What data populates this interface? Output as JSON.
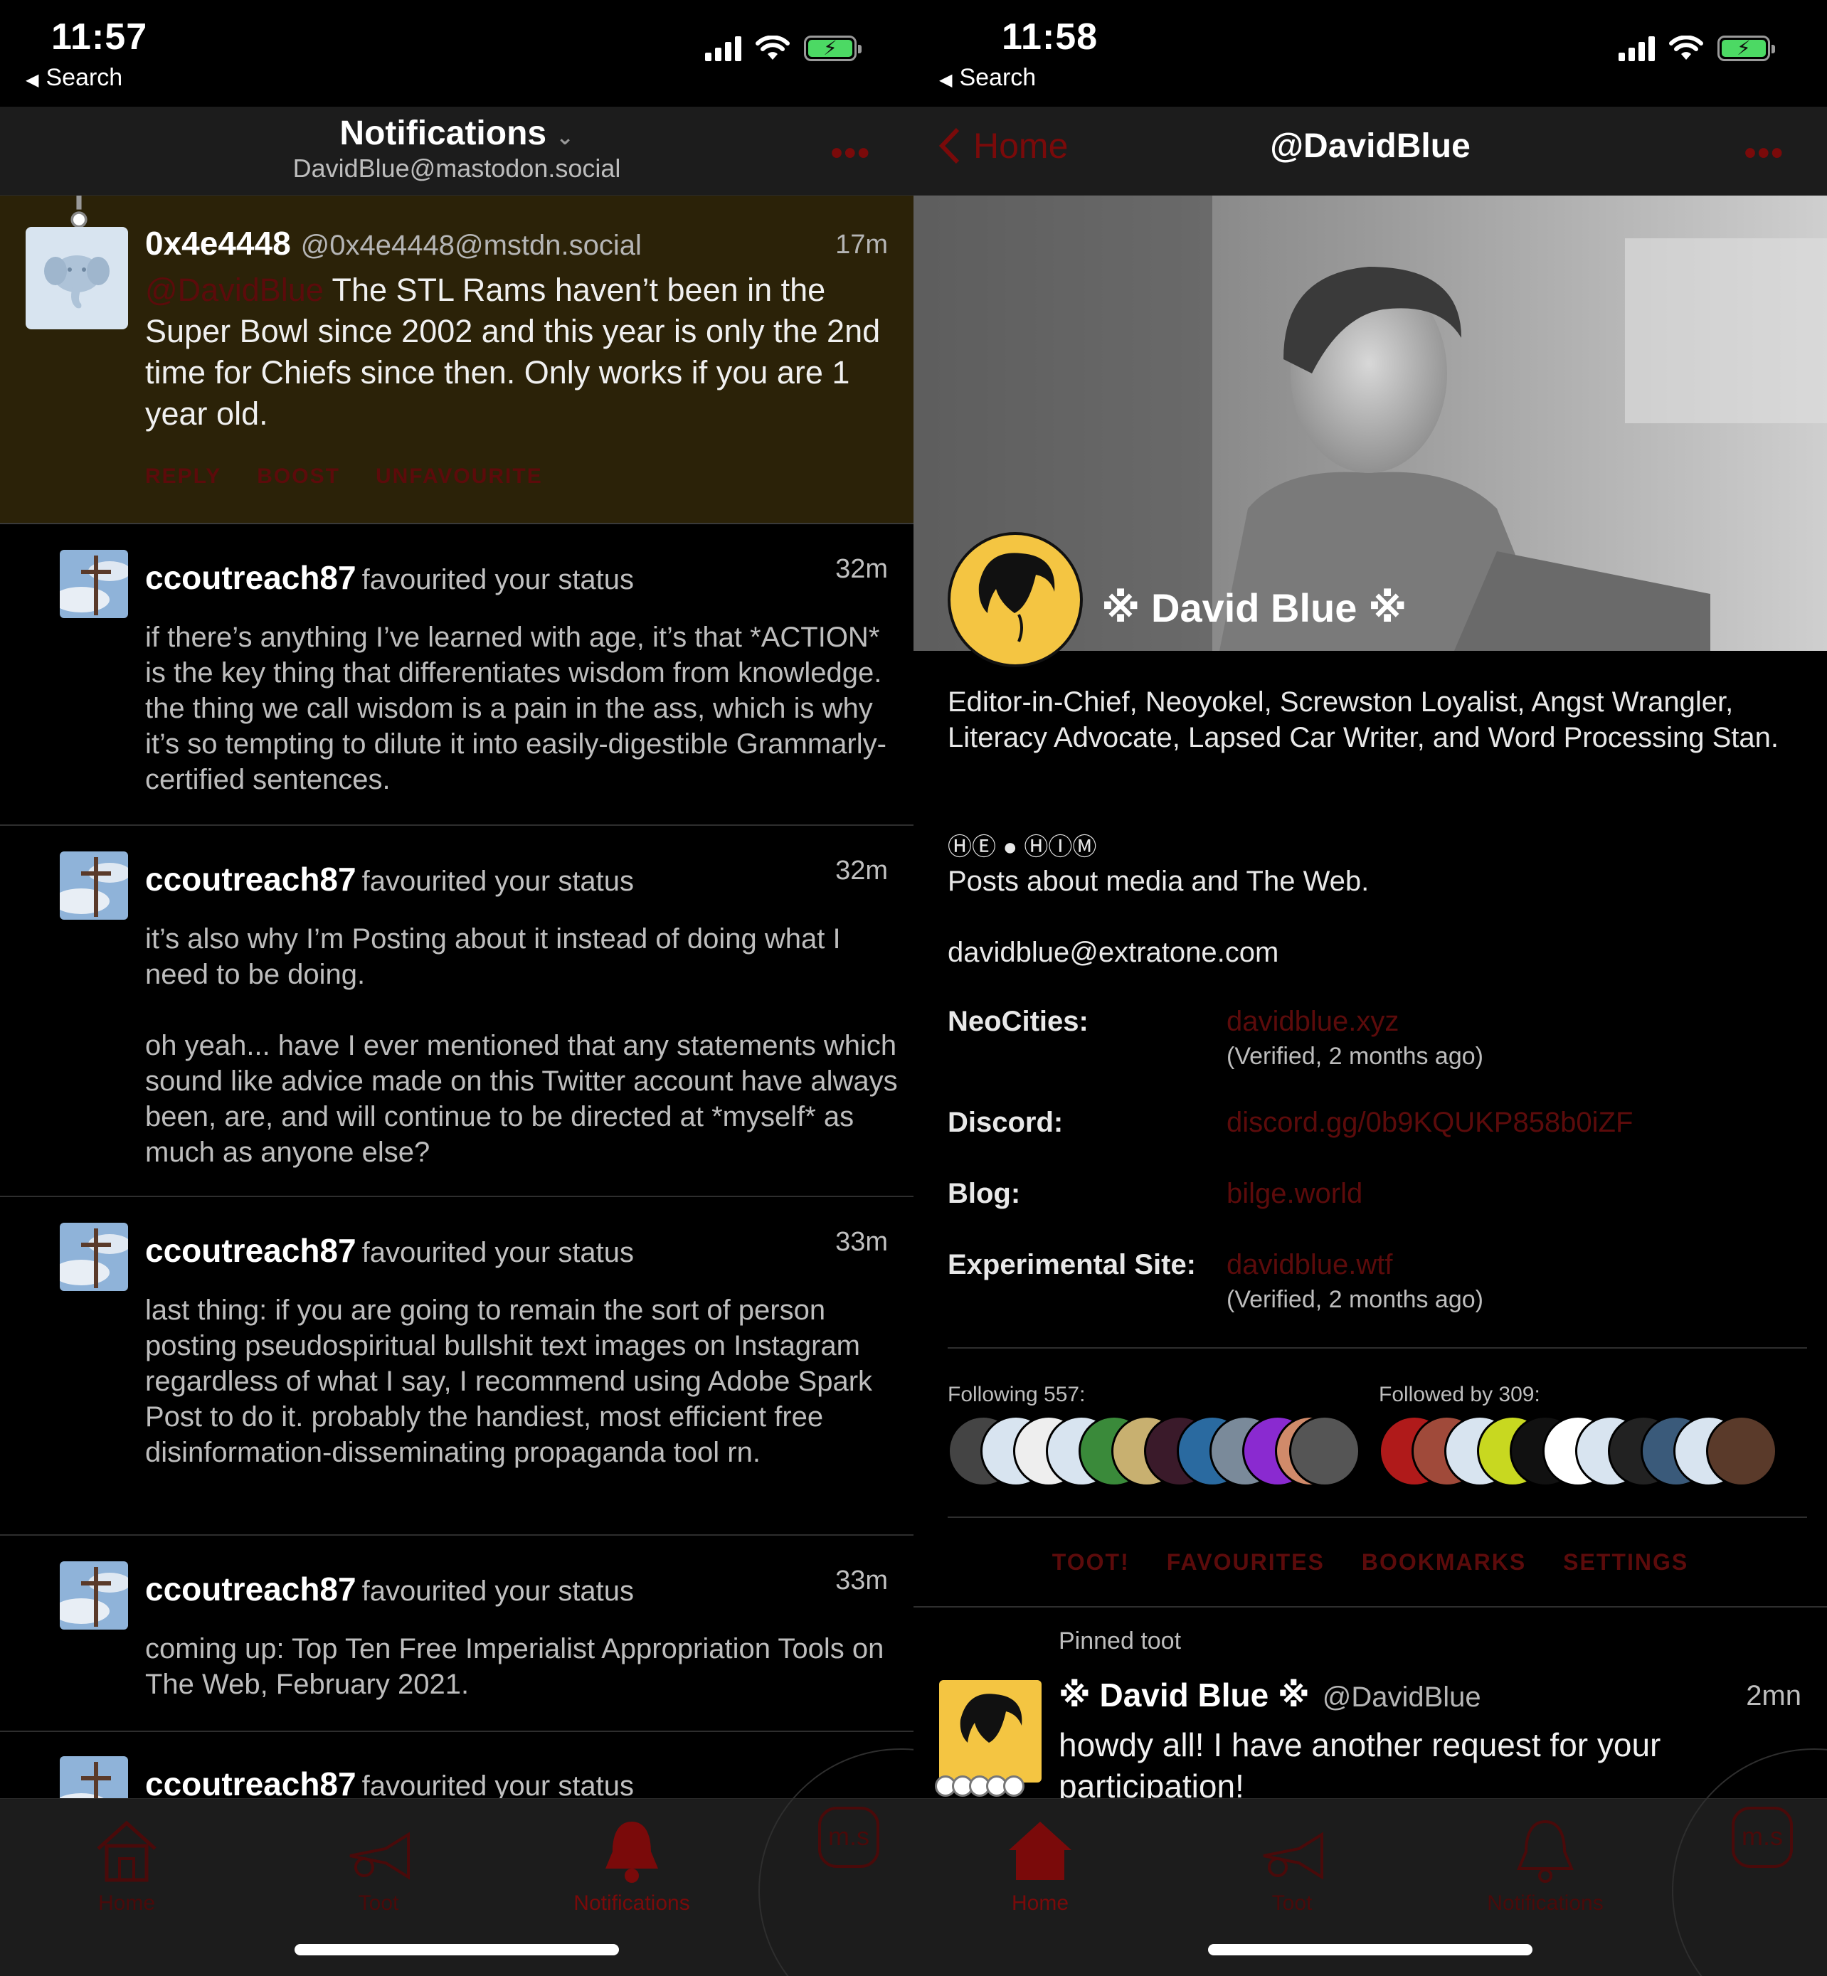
{
  "left": {
    "status": {
      "time": "11:57",
      "back": "Search"
    },
    "nav": {
      "title": "Notifications",
      "caret": "⌄",
      "subtitle": "DavidBlue@mastodon.social",
      "more": "•••"
    },
    "highlight": {
      "name": "0x4e4448",
      "handle": "@0x4e4448@mstdn.social",
      "time": "17m",
      "mention": "@DavidBlue",
      "text": " The STL Rams haven’t been in the Super Bowl since 2002 and this year is only the 2nd time for Chiefs since then. Only works if you are 1 year old.",
      "actions": [
        "REPLY",
        "BOOST",
        "UNFAVOURITE"
      ]
    },
    "notifications": [
      {
        "name": "ccoutreach87",
        "verb": "favourited your status",
        "time": "32m",
        "text": "if there’s anything I’ve learned with age, it’s that *ACTION* is the key thing that differentiates wisdom from knowledge. the thing we call wisdom is a pain in the ass, which is why it’s so tempting to dilute it into easily-digestible Grammarly-certified sentences."
      },
      {
        "name": "ccoutreach87",
        "verb": "favourited your status",
        "time": "32m",
        "text": "it’s also why I’m Posting about it instead of doing what I need to be doing.\n\noh yeah... have I ever mentioned that any statements which sound like advice made on this Twitter account have always been, are, and will continue to be directed at *myself* as much as anyone else?"
      },
      {
        "name": "ccoutreach87",
        "verb": "favourited your status",
        "time": "33m",
        "text": "last thing: if you are going to remain the sort of person posting pseudospiritual bullshit text images on Instagram regardless of what I say, I recommend using Adobe Spark Post to do it. probably the handiest, most efficient free disinformation-disseminating propaganda tool rn."
      },
      {
        "name": "ccoutreach87",
        "verb": "favourited your status",
        "time": "33m",
        "text": "coming up: Top Ten Free Imperialist Appropriation Tools on The Web, February 2021."
      },
      {
        "name": "ccoutreach87",
        "verb": "favourited your status",
        "time": "",
        "text": ""
      }
    ],
    "tabs": [
      "Home",
      "Toot",
      "Notifications"
    ],
    "badge": "m.s"
  },
  "right": {
    "status": {
      "time": "11:58",
      "back": "Search"
    },
    "nav": {
      "back": "Home",
      "title": "@DavidBlue",
      "more": "•••"
    },
    "profile": {
      "display_name": "※ David Blue ※",
      "bio": "Editor-in-Chief, Neoyokel, Screwston Loyalist, Angst Wrangler, Literacy Advocate, Lapsed Car Writer, and Word Processing Stan.",
      "pronouns": "ⒽⒺ ● ⒽⒾⓂ",
      "posts_about": "Posts about media and The Web.",
      "email": "davidblue@extratone.com",
      "fields": [
        {
          "key": "NeoCities:",
          "value": "davidblue.xyz",
          "verified": "(Verified, 2 months ago)"
        },
        {
          "key": "Discord:",
          "value": "discord.gg/0b9KQUKP858b0iZF",
          "verified": ""
        },
        {
          "key": "Blog:",
          "value": "bilge.world",
          "verified": ""
        },
        {
          "key": "Experimental Site:",
          "value": "davidblue.wtf",
          "verified": "(Verified, 2 months ago)"
        }
      ],
      "following": "Following 557:",
      "followed_by": "Followed by 309:",
      "actions": [
        "TOOT!",
        "FAVOURITES",
        "BOOKMARKS",
        "SETTINGS"
      ]
    },
    "pinned": {
      "label": "Pinned toot",
      "name": "※ David Blue ※",
      "handle": "@DavidBlue",
      "time": "2mn",
      "text": "howdy all! I have another request for your participation!"
    },
    "tabs": [
      "Home",
      "Toot",
      "Notifications"
    ],
    "badge": "m.s"
  },
  "colors": {
    "accent": "#5c0b0b",
    "highlight_bg": "#2b2208",
    "nav_bg": "#1c1c1c",
    "avatar_yellow": "#f4c542"
  }
}
